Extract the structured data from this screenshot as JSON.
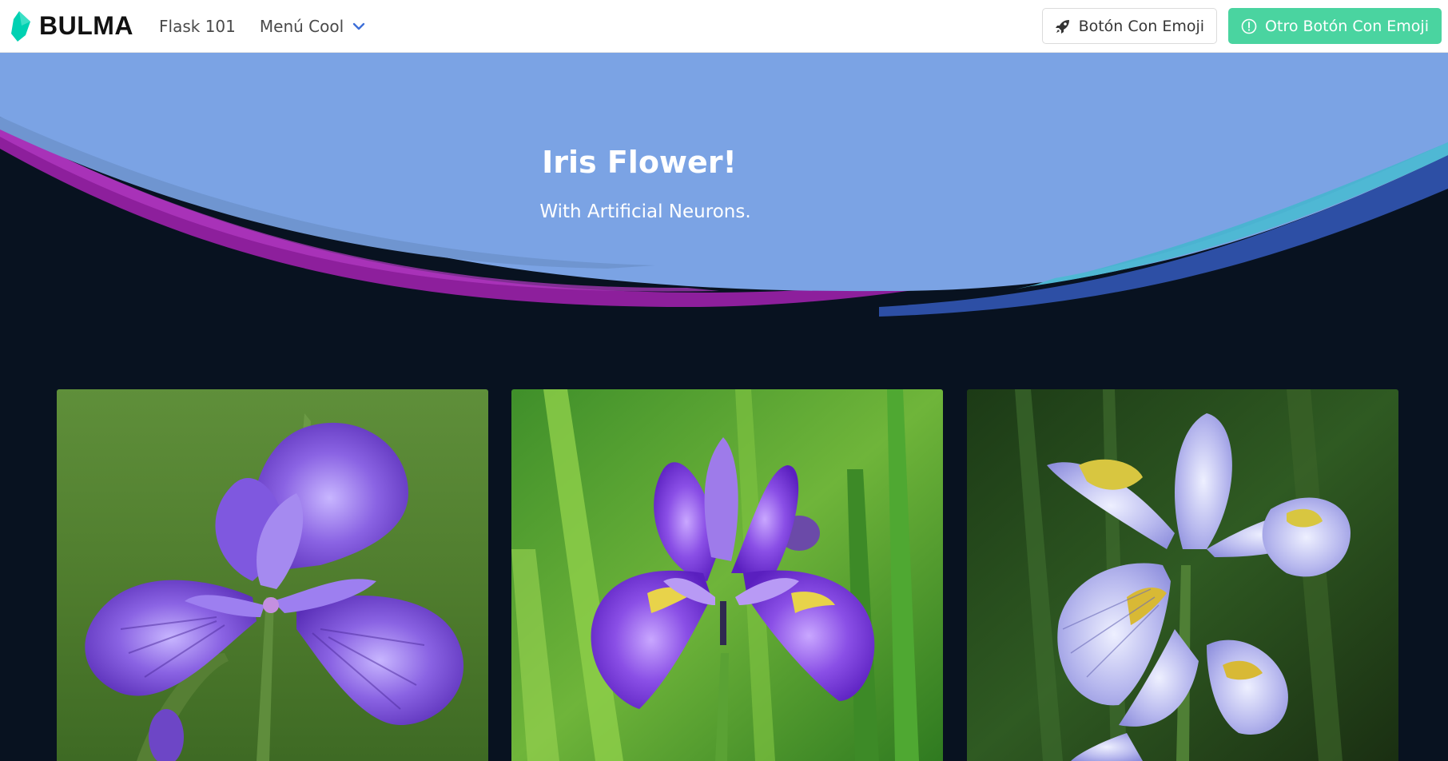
{
  "navbar": {
    "brand": "BULMA",
    "links": [
      "Flask 101",
      "Menú Cool"
    ],
    "buttons": {
      "rocket_label": "Botón Con Emoji",
      "info_label": "Otro Botón Con Emoji"
    }
  },
  "hero": {
    "title": "Iris Flower!",
    "subtitle": "With Artificial Neurons."
  },
  "gallery": {
    "images": [
      "iris-setosa-photo",
      "iris-versicolor-photo",
      "iris-virginica-photo"
    ]
  },
  "colors": {
    "brand_accent": "#4ad4a0",
    "hero_blue": "#7ba3e4",
    "wave_magenta": "#9b2ab3",
    "wave_teal": "#4bb3d1",
    "background": "#081220"
  }
}
